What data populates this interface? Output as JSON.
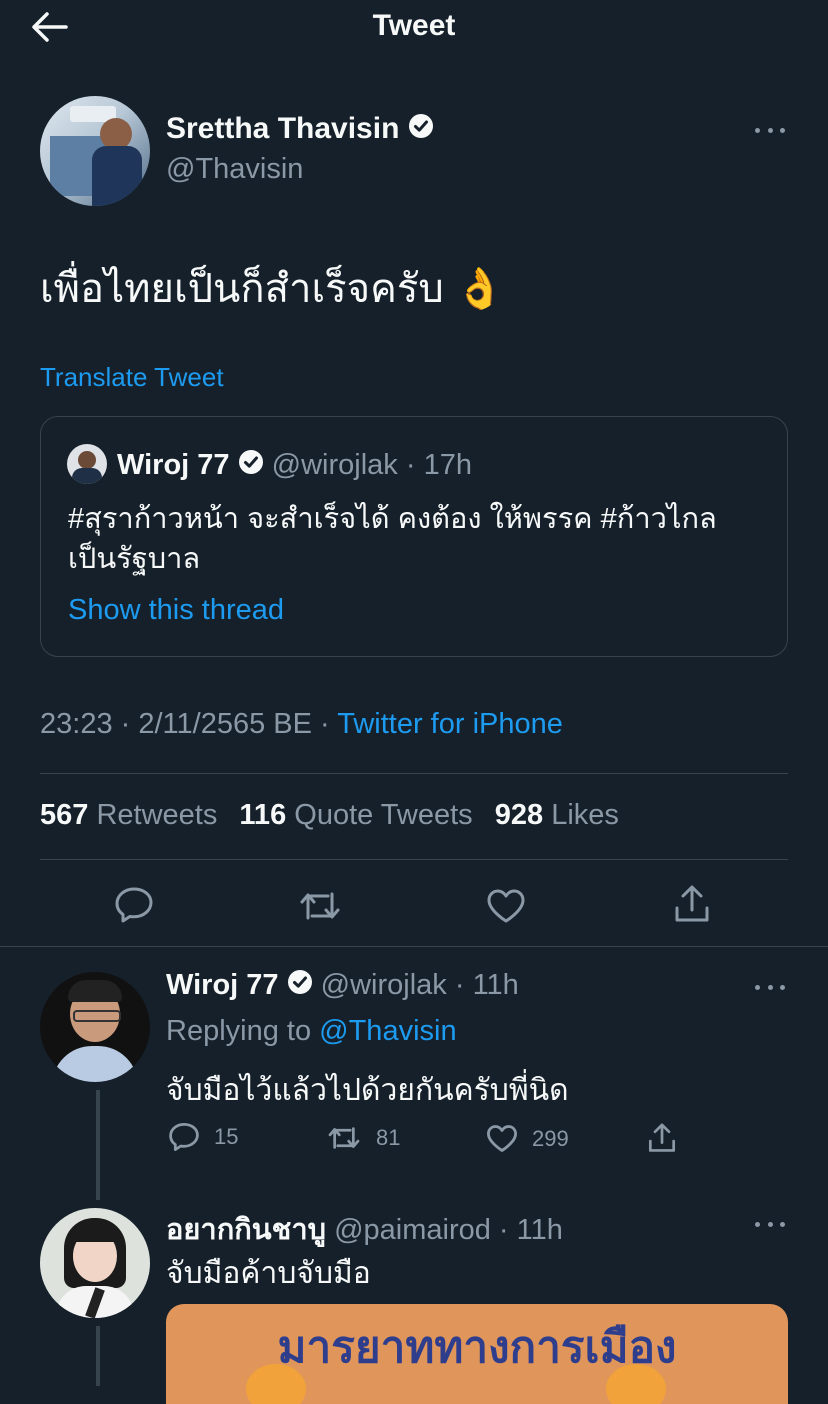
{
  "header": {
    "title": "Tweet"
  },
  "tweet": {
    "author_name": "Srettha Thavisin",
    "author_handle": "@Thavisin",
    "text": "เพื่อไทยเป็นก็สำเร็จครับ 👌",
    "translate_label": "Translate Tweet",
    "quoted": {
      "author_name": "Wiroj 77",
      "author_handle": "@wirojlak",
      "time": "17h",
      "text": "#สุราก้าวหน้า จะสำเร็จได้ คงต้อง ให้พรรค #ก้าวไกล เป็นรัฐบาล",
      "show_thread": "Show this thread"
    },
    "timestamp": "23:23 · 2/11/2565 BE",
    "source": "Twitter for iPhone",
    "stats": {
      "retweets_count": "567",
      "retweets_label": "Retweets",
      "quotes_count": "116",
      "quotes_label": "Quote Tweets",
      "likes_count": "928",
      "likes_label": "Likes"
    }
  },
  "replies": [
    {
      "author_name": "Wiroj 77",
      "author_handle": "@wirojlak",
      "time": "11h",
      "replying_prefix": "Replying to",
      "replying_to": "@Thavisin",
      "text": "จับมือไว้แล้วไปด้วยกันครับพี่นิด",
      "reply_count": "15",
      "retweet_count": "81",
      "like_count": "299"
    },
    {
      "author_name": "อยากกินชาบู",
      "author_handle": "@paimairod",
      "time": "11h",
      "text": "จับมือค้าบจับมือ",
      "image_text": "มารยาททางการเมือง"
    }
  ],
  "colors": {
    "background": "#15202b",
    "accent": "#1d9bf0",
    "muted": "#8b98a5",
    "border": "#38444d"
  }
}
